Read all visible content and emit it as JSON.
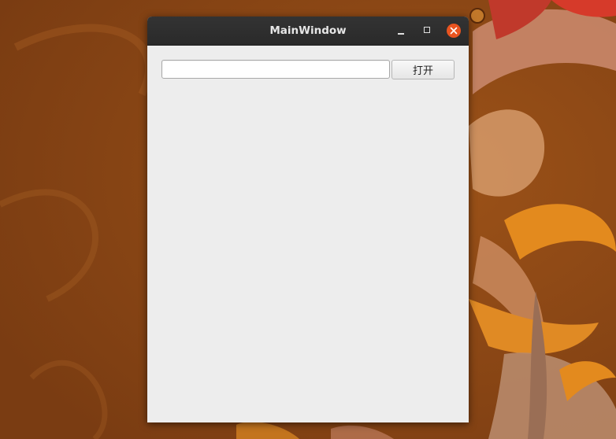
{
  "window": {
    "title": "MainWindow",
    "controls": {
      "minimize": "minimize-icon",
      "maximize": "maximize-icon",
      "close": "close-icon"
    }
  },
  "form": {
    "path_value": "",
    "path_placeholder": "",
    "open_label": "打开"
  },
  "colors": {
    "desktop_bg": "#8a4614",
    "titlebar_bg": "#2c2c2c",
    "close_accent": "#e95420",
    "window_bg": "#ededed"
  }
}
